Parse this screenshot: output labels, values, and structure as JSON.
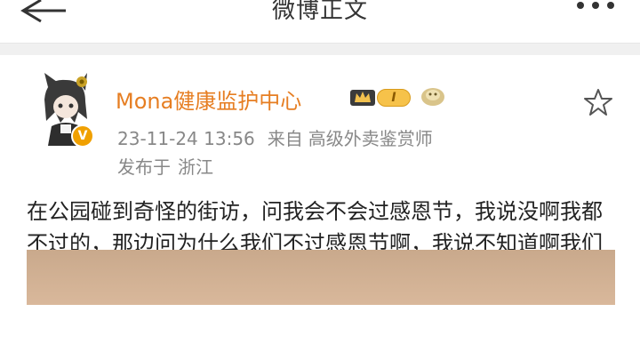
{
  "header": {
    "title": "微博正文",
    "back_icon": "back-arrow-icon",
    "more_icon": "more-dots-icon"
  },
  "post": {
    "author": {
      "name": "Mona健康监护中心",
      "avatar": "anime-avatar",
      "verified_badge": "V",
      "level_label": "I",
      "badges": [
        "crown-icon",
        "fan-badge-icon"
      ]
    },
    "timestamp": "23-11-24 13:56",
    "source_label": "来自",
    "source_value": "高级外卖鉴赏师",
    "location_label": "发布于",
    "location_value": "浙江",
    "text": "在公园碰到奇怪的街访，问我会不会过感恩节，我说没啊我都不过的，那边问为什么我们不过感恩节啊，我说不知道啊我们又没杀过印第安人（）",
    "favorite_icon": "star-icon"
  },
  "colors": {
    "username": "#e67e22",
    "meta": "#888888",
    "image_tone": "#d2b294"
  }
}
